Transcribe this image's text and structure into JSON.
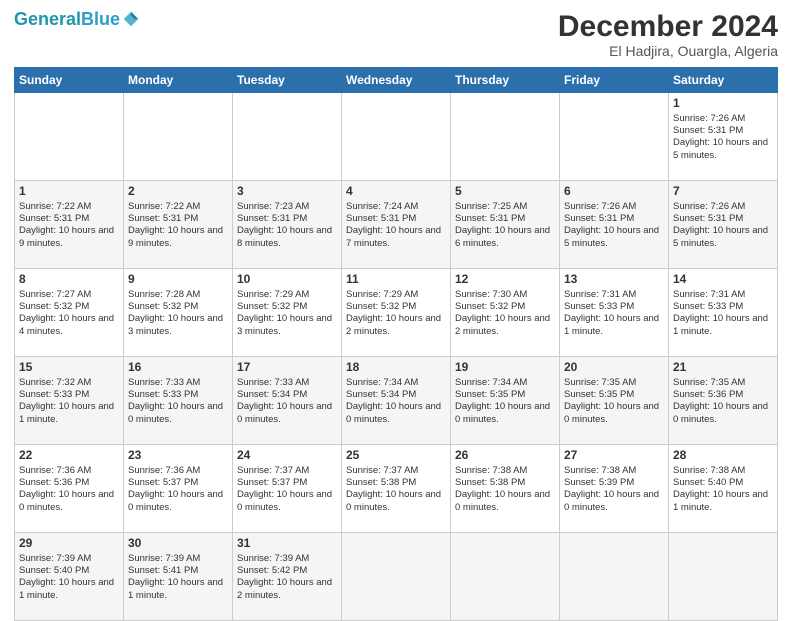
{
  "header": {
    "logo_line1": "General",
    "logo_line2": "Blue",
    "main_title": "December 2024",
    "subtitle": "El Hadjira, Ouargla, Algeria"
  },
  "calendar": {
    "days_of_week": [
      "Sunday",
      "Monday",
      "Tuesday",
      "Wednesday",
      "Thursday",
      "Friday",
      "Saturday"
    ],
    "weeks": [
      [
        {
          "day": "",
          "empty": true
        },
        {
          "day": "",
          "empty": true
        },
        {
          "day": "",
          "empty": true
        },
        {
          "day": "",
          "empty": true
        },
        {
          "day": "",
          "empty": true
        },
        {
          "day": "",
          "empty": true
        },
        {
          "day": "1",
          "sunrise": "7:26 AM",
          "sunset": "5:31 PM",
          "daylight": "10 hours and 5 minutes."
        }
      ],
      [
        {
          "day": "1",
          "sunrise": "7:22 AM",
          "sunset": "5:31 PM",
          "daylight": "10 hours and 9 minutes."
        },
        {
          "day": "2",
          "sunrise": "7:22 AM",
          "sunset": "5:31 PM",
          "daylight": "10 hours and 9 minutes."
        },
        {
          "day": "3",
          "sunrise": "7:23 AM",
          "sunset": "5:31 PM",
          "daylight": "10 hours and 8 minutes."
        },
        {
          "day": "4",
          "sunrise": "7:24 AM",
          "sunset": "5:31 PM",
          "daylight": "10 hours and 7 minutes."
        },
        {
          "day": "5",
          "sunrise": "7:25 AM",
          "sunset": "5:31 PM",
          "daylight": "10 hours and 6 minutes."
        },
        {
          "day": "6",
          "sunrise": "7:26 AM",
          "sunset": "5:31 PM",
          "daylight": "10 hours and 5 minutes."
        },
        {
          "day": "7",
          "sunrise": "7:26 AM",
          "sunset": "5:31 PM",
          "daylight": "10 hours and 5 minutes."
        }
      ],
      [
        {
          "day": "8",
          "sunrise": "7:27 AM",
          "sunset": "5:32 PM",
          "daylight": "10 hours and 4 minutes."
        },
        {
          "day": "9",
          "sunrise": "7:28 AM",
          "sunset": "5:32 PM",
          "daylight": "10 hours and 3 minutes."
        },
        {
          "day": "10",
          "sunrise": "7:29 AM",
          "sunset": "5:32 PM",
          "daylight": "10 hours and 3 minutes."
        },
        {
          "day": "11",
          "sunrise": "7:29 AM",
          "sunset": "5:32 PM",
          "daylight": "10 hours and 2 minutes."
        },
        {
          "day": "12",
          "sunrise": "7:30 AM",
          "sunset": "5:32 PM",
          "daylight": "10 hours and 2 minutes."
        },
        {
          "day": "13",
          "sunrise": "7:31 AM",
          "sunset": "5:33 PM",
          "daylight": "10 hours and 1 minute."
        },
        {
          "day": "14",
          "sunrise": "7:31 AM",
          "sunset": "5:33 PM",
          "daylight": "10 hours and 1 minute."
        }
      ],
      [
        {
          "day": "15",
          "sunrise": "7:32 AM",
          "sunset": "5:33 PM",
          "daylight": "10 hours and 1 minute."
        },
        {
          "day": "16",
          "sunrise": "7:33 AM",
          "sunset": "5:33 PM",
          "daylight": "10 hours and 0 minutes."
        },
        {
          "day": "17",
          "sunrise": "7:33 AM",
          "sunset": "5:34 PM",
          "daylight": "10 hours and 0 minutes."
        },
        {
          "day": "18",
          "sunrise": "7:34 AM",
          "sunset": "5:34 PM",
          "daylight": "10 hours and 0 minutes."
        },
        {
          "day": "19",
          "sunrise": "7:34 AM",
          "sunset": "5:35 PM",
          "daylight": "10 hours and 0 minutes."
        },
        {
          "day": "20",
          "sunrise": "7:35 AM",
          "sunset": "5:35 PM",
          "daylight": "10 hours and 0 minutes."
        },
        {
          "day": "21",
          "sunrise": "7:35 AM",
          "sunset": "5:36 PM",
          "daylight": "10 hours and 0 minutes."
        }
      ],
      [
        {
          "day": "22",
          "sunrise": "7:36 AM",
          "sunset": "5:36 PM",
          "daylight": "10 hours and 0 minutes."
        },
        {
          "day": "23",
          "sunrise": "7:36 AM",
          "sunset": "5:37 PM",
          "daylight": "10 hours and 0 minutes."
        },
        {
          "day": "24",
          "sunrise": "7:37 AM",
          "sunset": "5:37 PM",
          "daylight": "10 hours and 0 minutes."
        },
        {
          "day": "25",
          "sunrise": "7:37 AM",
          "sunset": "5:38 PM",
          "daylight": "10 hours and 0 minutes."
        },
        {
          "day": "26",
          "sunrise": "7:38 AM",
          "sunset": "5:38 PM",
          "daylight": "10 hours and 0 minutes."
        },
        {
          "day": "27",
          "sunrise": "7:38 AM",
          "sunset": "5:39 PM",
          "daylight": "10 hours and 0 minutes."
        },
        {
          "day": "28",
          "sunrise": "7:38 AM",
          "sunset": "5:40 PM",
          "daylight": "10 hours and 1 minute."
        }
      ],
      [
        {
          "day": "29",
          "sunrise": "7:39 AM",
          "sunset": "5:40 PM",
          "daylight": "10 hours and 1 minute."
        },
        {
          "day": "30",
          "sunrise": "7:39 AM",
          "sunset": "5:41 PM",
          "daylight": "10 hours and 1 minute."
        },
        {
          "day": "31",
          "sunrise": "7:39 AM",
          "sunset": "5:42 PM",
          "daylight": "10 hours and 2 minutes."
        },
        {
          "day": "",
          "empty": true
        },
        {
          "day": "",
          "empty": true
        },
        {
          "day": "",
          "empty": true
        },
        {
          "day": "",
          "empty": true
        }
      ]
    ]
  },
  "labels": {
    "sunrise": "Sunrise:",
    "sunset": "Sunset:",
    "daylight": "Daylight:"
  }
}
